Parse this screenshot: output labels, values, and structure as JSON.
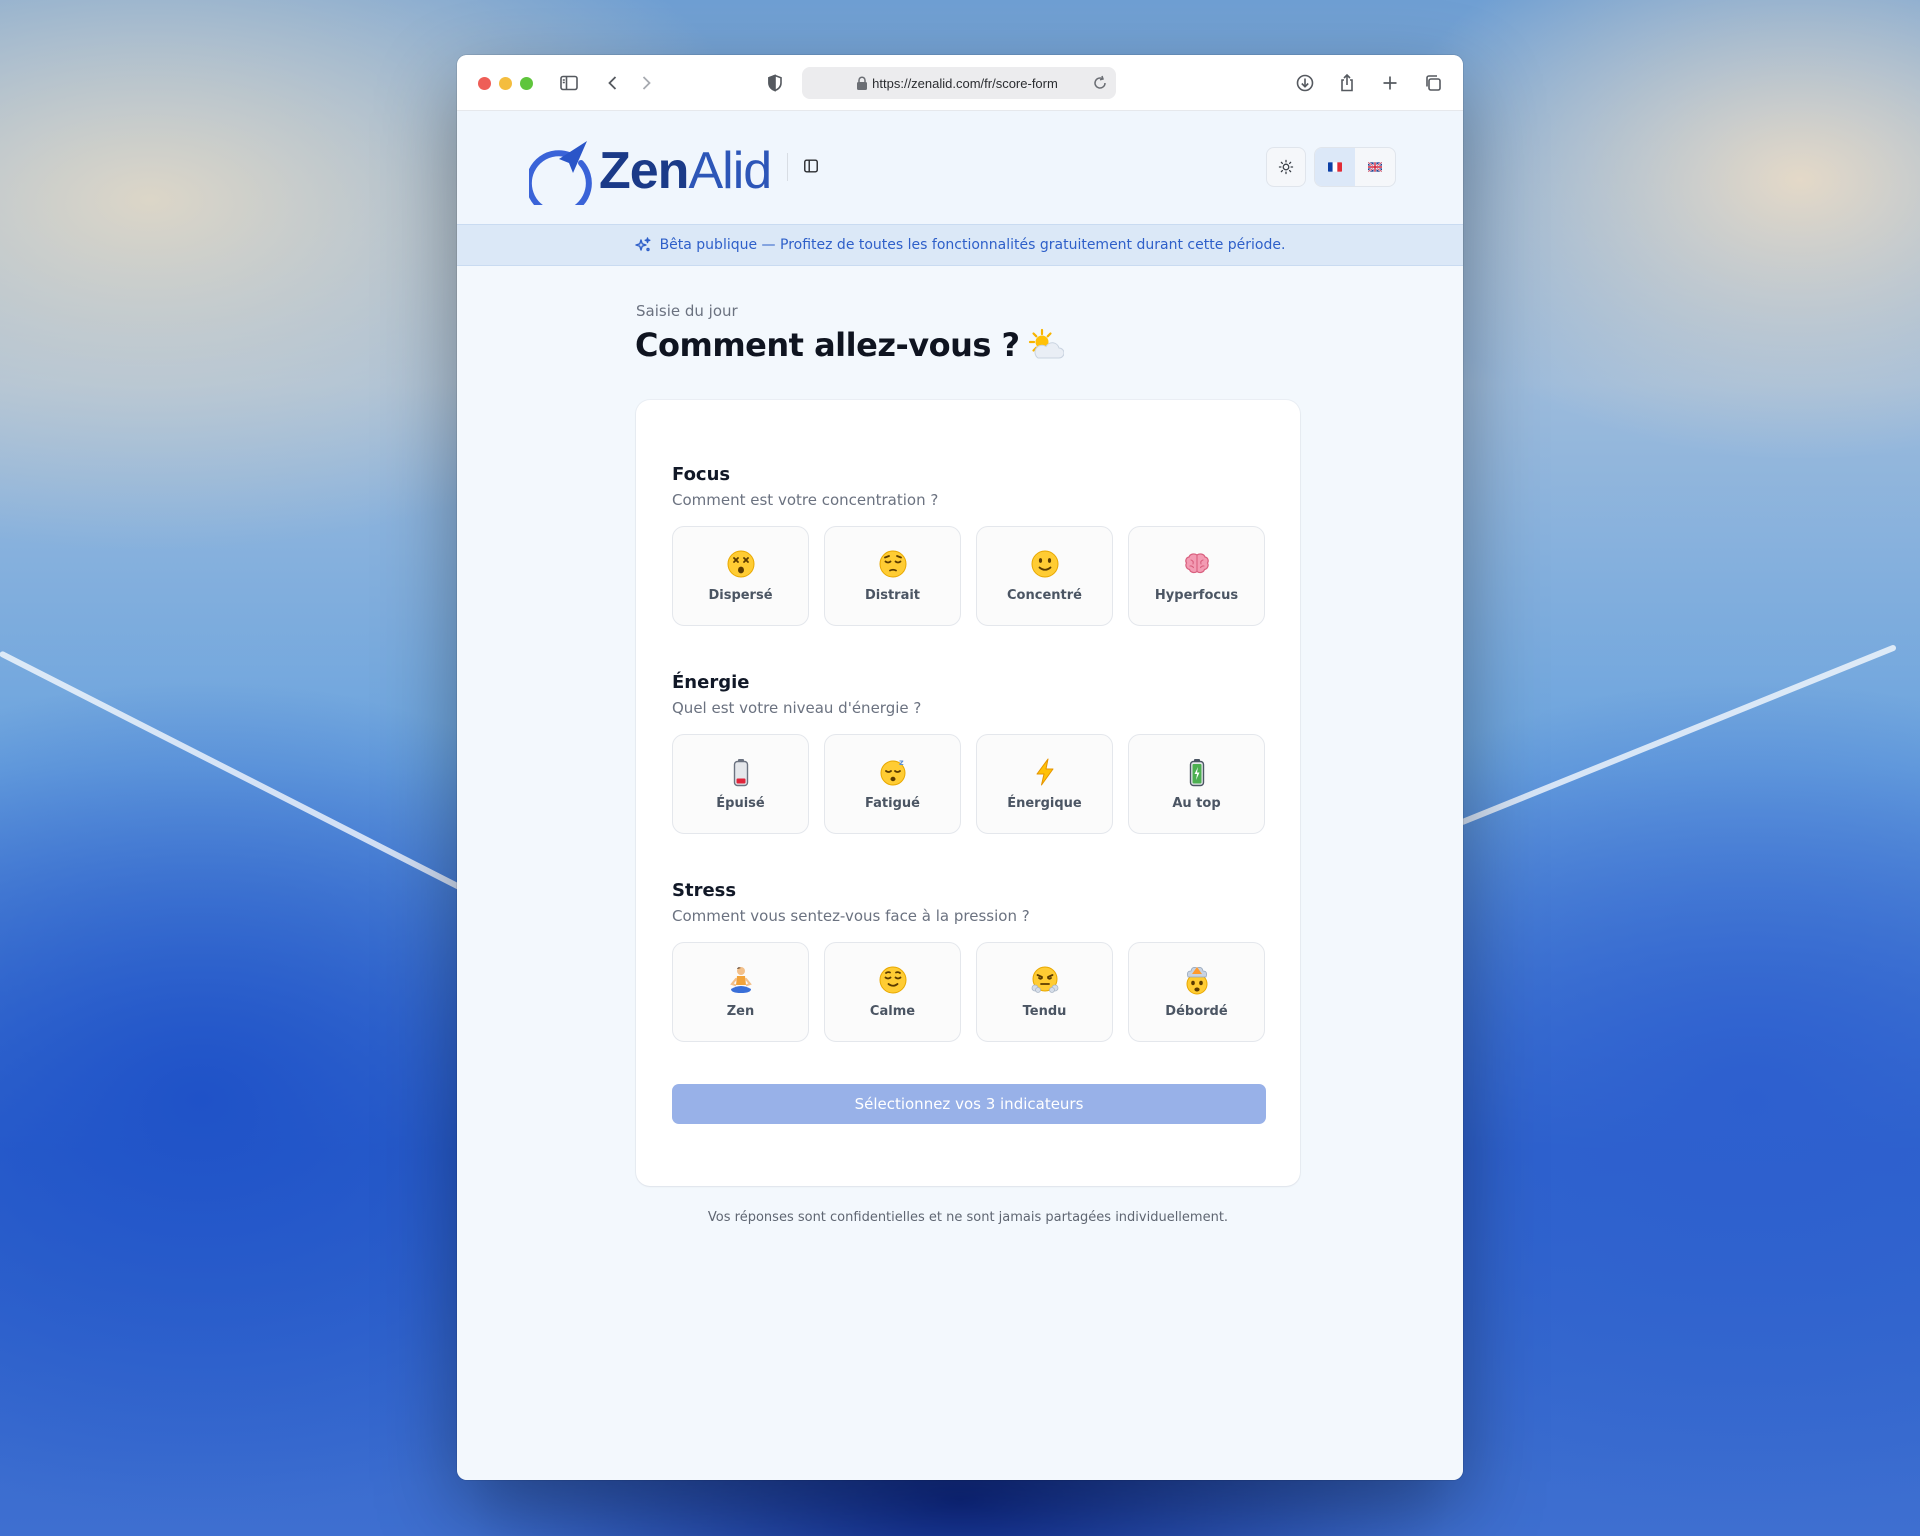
{
  "browser": {
    "url": "https://zenalid.com/fr/score-form"
  },
  "header": {
    "logo_bold": "Zen",
    "logo_light": "Alid",
    "languages": [
      {
        "code": "fr",
        "active": true
      },
      {
        "code": "en",
        "active": false
      }
    ]
  },
  "banner": {
    "text": "Bêta publique — Profitez de toutes les fonctionnalités gratuitement durant cette période."
  },
  "main": {
    "eyebrow": "Saisie du jour",
    "title": "Comment allez-vous ?",
    "sections": [
      {
        "title": "Focus",
        "subtitle": "Comment est votre concentration ?",
        "options": [
          {
            "label": "Dispersé",
            "icon": "dizzy-face-icon"
          },
          {
            "label": "Distrait",
            "icon": "pensive-face-icon"
          },
          {
            "label": "Concentré",
            "icon": "slight-smile-icon"
          },
          {
            "label": "Hyperfocus",
            "icon": "brain-icon"
          }
        ]
      },
      {
        "title": "Énergie",
        "subtitle": "Quel est votre niveau d'énergie ?",
        "options": [
          {
            "label": "Épuisé",
            "icon": "low-battery-icon"
          },
          {
            "label": "Fatigué",
            "icon": "sleeping-face-icon"
          },
          {
            "label": "Énergique",
            "icon": "lightning-icon"
          },
          {
            "label": "Au top",
            "icon": "full-battery-icon"
          }
        ]
      },
      {
        "title": "Stress",
        "subtitle": "Comment vous sentez-vous face à la pression ?",
        "options": [
          {
            "label": "Zen",
            "icon": "meditation-icon"
          },
          {
            "label": "Calme",
            "icon": "relieved-face-icon"
          },
          {
            "label": "Tendu",
            "icon": "steam-face-icon"
          },
          {
            "label": "Débordé",
            "icon": "exploding-head-icon"
          }
        ]
      }
    ],
    "submit_label": "Sélectionnez vos 3 indicateurs",
    "footnote": "Vos réponses sont confidentielles et ne sont jamais partagées individuellement."
  },
  "colors": {
    "accent": "#2e5fc9",
    "submit_disabled": "#98b1e8",
    "banner_bg": "#dbe8f7"
  }
}
